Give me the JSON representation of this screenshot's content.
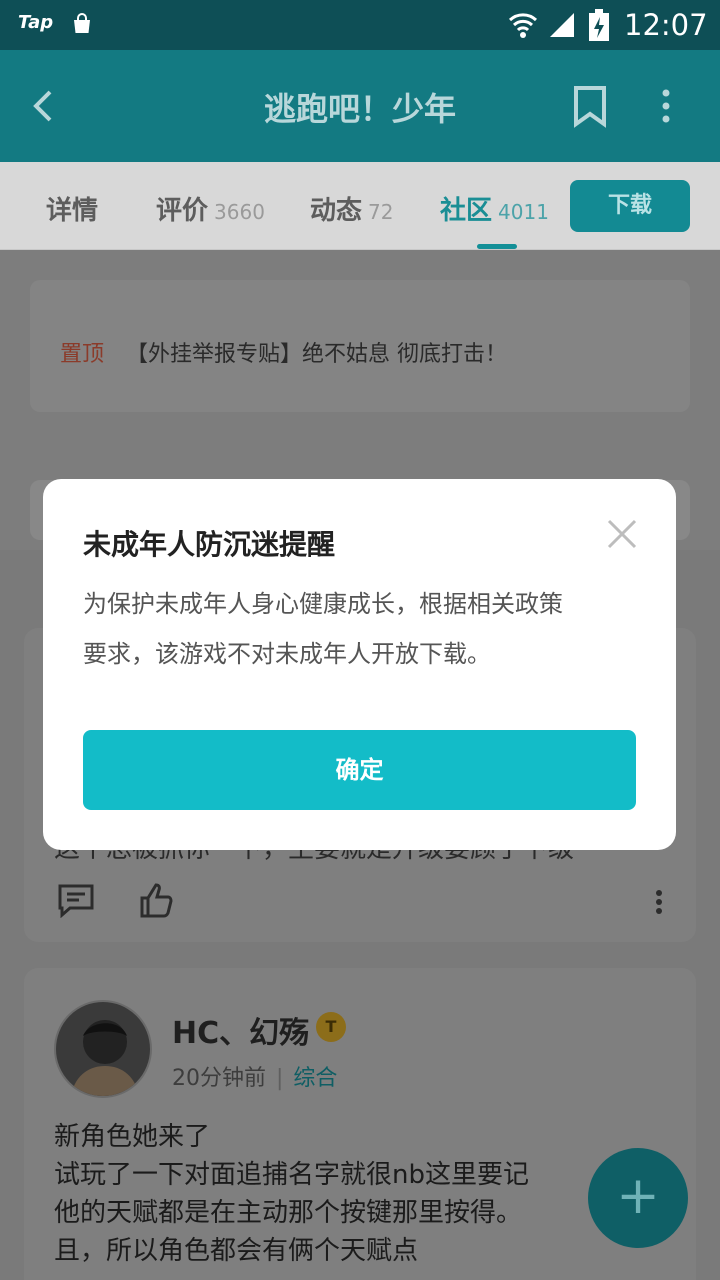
{
  "status_bar": {
    "app_label": "Tap",
    "time": "12:07"
  },
  "app_bar": {
    "title": "逃跑吧！少年"
  },
  "tabs": [
    {
      "label": "详情",
      "count": ""
    },
    {
      "label": "评价",
      "count": "3660"
    },
    {
      "label": "动态",
      "count": "72"
    },
    {
      "label": "社区",
      "count": "4011"
    }
  ],
  "download_label": "下载",
  "pinned": {
    "tag": "置顶",
    "text": "【外挂举报专贴】绝不姑息 彻底打击！"
  },
  "card1": {
    "tail_text": "这个总被抓你一下，主要就是升级要顾了下级"
  },
  "card2": {
    "username": "HC、幻殇",
    "badge": "T",
    "time": "20分钟前",
    "category": "综合",
    "lines": [
      "新角色她来了",
      "试玩了一下对面追捕名字就很nb这里要记",
      "他的天赋都是在主动那个按键那里按得。",
      "且，所以角色都会有俩个天赋点"
    ]
  },
  "fab_label": "+",
  "dialog": {
    "title": "未成年人防沉迷提醒",
    "body_line1": "为保护未成年人身心健康成长，根据相关政策",
    "body_line2": "要求，该游戏不对未成年人开放下载。",
    "confirm_label": "确定"
  }
}
